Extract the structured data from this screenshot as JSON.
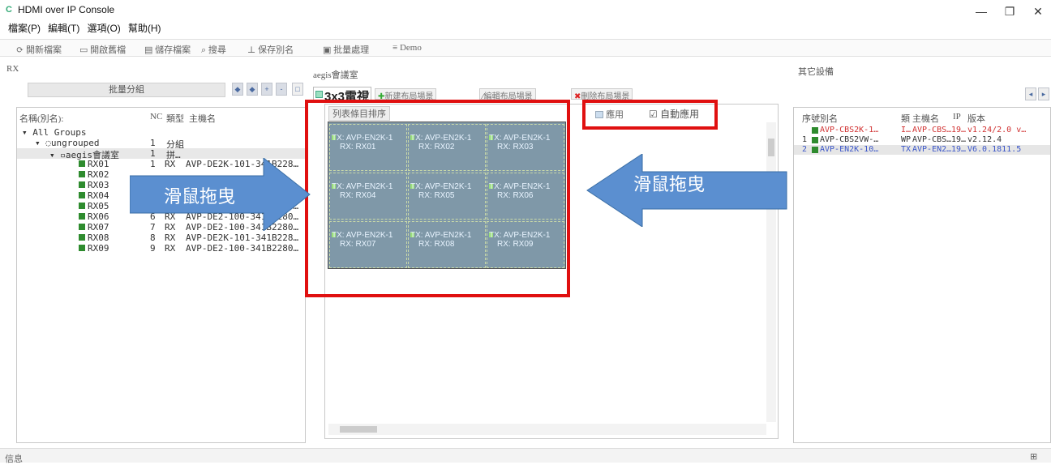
{
  "window": {
    "title": "HDMI over IP Console",
    "icon": "app-logo-icon",
    "controls": [
      "—",
      "❐",
      "✕"
    ]
  },
  "menu": [
    "檔案(P)",
    "編輯(T)",
    "選項(O)",
    "幫助(H)"
  ],
  "toolbar": [
    "開新檔案",
    "開啟舊檔",
    "儲存檔案",
    "搜尋",
    "保存別名",
    "批量處理",
    "Demo"
  ],
  "left_panel": {
    "title": "RX",
    "batch_button": "批量分組",
    "small_buttons": [
      "◆",
      "◆",
      "+",
      "-",
      "□"
    ],
    "columns": [
      "名稱(別名):",
      "NC",
      "類型",
      "主機名"
    ],
    "tree": {
      "all_groups": "All Groups",
      "ungrouped": "ungrouped",
      "ungrouped_nc": "1",
      "ungrouped_type": "分組",
      "room": "aegis會議室",
      "room_nc": "1",
      "room_type": "拼…",
      "rx": [
        {
          "name": "RX01",
          "nc": "1",
          "type": "RX",
          "host": "AVP-DE2K-101-341B228…"
        },
        {
          "name": "RX02",
          "nc": "",
          "type": "",
          "host": ""
        },
        {
          "name": "RX03",
          "nc": "",
          "type": "",
          "host": ""
        },
        {
          "name": "RX04",
          "nc": "",
          "type": "",
          "host": ""
        },
        {
          "name": "RX05",
          "nc": "5",
          "type": "RX",
          "host": "AVP-DE2-100-341B2280…"
        },
        {
          "name": "RX06",
          "nc": "6",
          "type": "RX",
          "host": "AVP-DE2-100-341B2280…"
        },
        {
          "name": "RX07",
          "nc": "7",
          "type": "RX",
          "host": "AVP-DE2-100-341B2280…"
        },
        {
          "name": "RX08",
          "nc": "8",
          "type": "RX",
          "host": "AVP-DE2K-101-341B228…"
        },
        {
          "name": "RX09",
          "nc": "9",
          "type": "RX",
          "host": "AVP-DE2-100-341B2280…"
        }
      ]
    }
  },
  "center_panel": {
    "title": "aegis會議室",
    "layout_select": "3x3電視",
    "buttons": [
      "新建布局場景",
      "編輯布局場景",
      "刪除布局場景"
    ],
    "list_sort": "列表條目排序",
    "apply_label": "應用",
    "auto_apply_label": "自動應用",
    "cells": [
      {
        "tx": "TX: AVP-EN2K-1",
        "rx": "RX: RX01"
      },
      {
        "tx": "TX: AVP-EN2K-1",
        "rx": "RX: RX02"
      },
      {
        "tx": "TX: AVP-EN2K-1",
        "rx": "RX: RX03"
      },
      {
        "tx": "TX: AVP-EN2K-1",
        "rx": "RX: RX04"
      },
      {
        "tx": "TX: AVP-EN2K-1",
        "rx": "RX: RX05"
      },
      {
        "tx": "TX: AVP-EN2K-1",
        "rx": "RX: RX06"
      },
      {
        "tx": "TX: AVP-EN2K-1",
        "rx": "RX: RX07"
      },
      {
        "tx": "TX: AVP-EN2K-1",
        "rx": "RX: RX08"
      },
      {
        "tx": "TX: AVP-EN2K-1",
        "rx": "RX: RX09"
      }
    ]
  },
  "annotations": {
    "left_arrow_text": "滑鼠拖曳",
    "right_arrow_text": "滑鼠拖曳",
    "arrow_color": "#5b8fd0",
    "highlight_color": "#e01010"
  },
  "right_panel": {
    "title": "其它設備",
    "columns": [
      "序號",
      "別名",
      "類",
      "主機名",
      "IP",
      "版本"
    ],
    "rows": [
      {
        "idx": "",
        "name": "AVP-CBS2K-1…",
        "type": "I…",
        "host": "AVP-CBS…",
        "ip": "19…",
        "ver": "v1.24/2.0 v…",
        "color": "#d03030"
      },
      {
        "idx": "1",
        "name": "AVP-CBS2VW-…",
        "type": "WP",
        "host": "AVP-CBS…",
        "ip": "19…",
        "ver": "v2.12.4",
        "color": "#333333"
      },
      {
        "idx": "2",
        "name": "AVP-EN2K-10…",
        "type": "TX",
        "host": "AVP-EN2…",
        "ip": "19…",
        "ver": "V6.0.1811.5",
        "color": "#3a55c8"
      }
    ]
  },
  "statusbar": {
    "label": "信息"
  }
}
